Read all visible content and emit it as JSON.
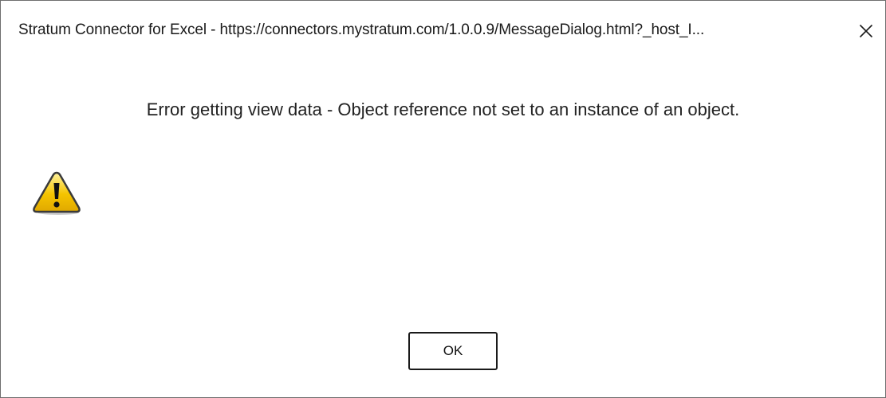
{
  "window": {
    "title": "Stratum Connector for Excel - https://connectors.mystratum.com/1.0.0.9/MessageDialog.html?_host_I..."
  },
  "dialog": {
    "message": "Error getting view data - Object reference not set to an instance of an object.",
    "icon": "warning-icon",
    "ok_label": "OK"
  },
  "colors": {
    "warning_fill": "#f5c400",
    "warning_outline": "#3a3a3a"
  }
}
